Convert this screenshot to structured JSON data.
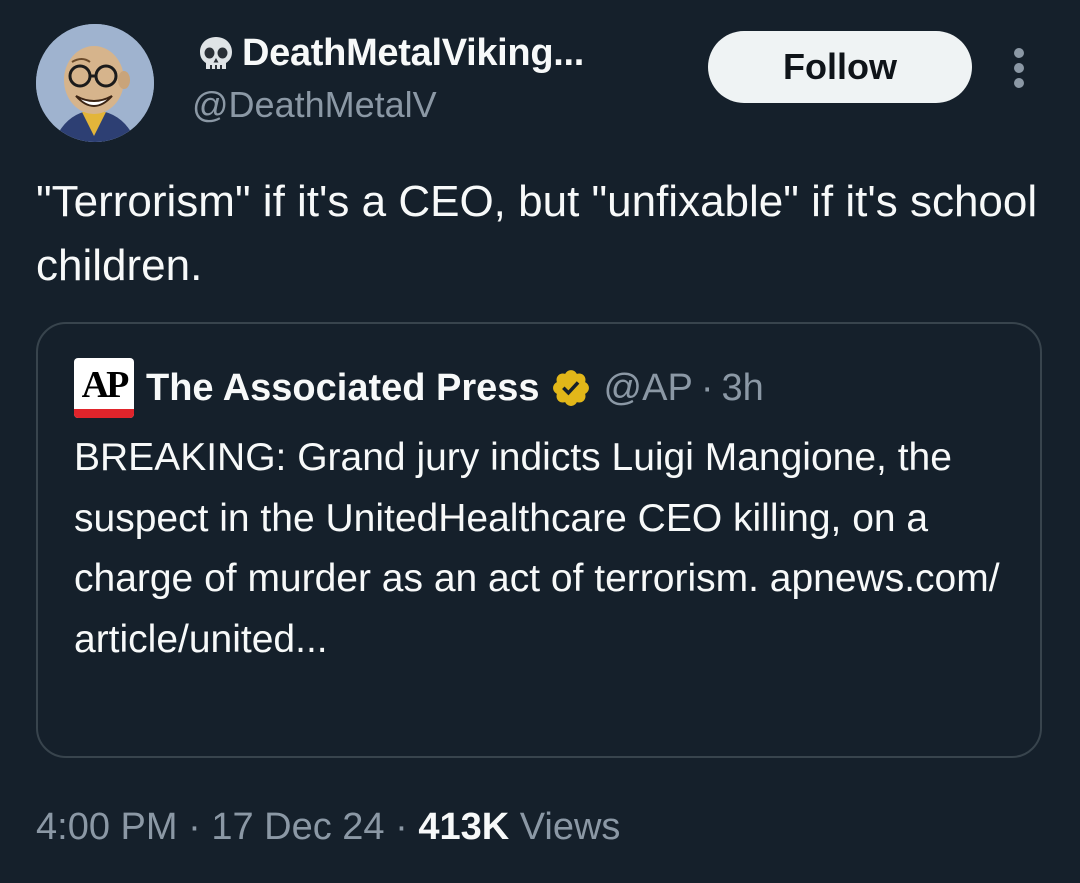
{
  "author": {
    "display_name": "DeathMetalViking...",
    "handle": "@DeathMetalV",
    "avatar_icon": "cartoon-face-avatar",
    "name_emoji_icon": "skull-icon"
  },
  "actions": {
    "follow_label": "Follow",
    "more_icon": "vertical-ellipsis-icon"
  },
  "tweet": {
    "text": "\"Terrorism\" if it's a CEO, but \"unfixable\" if it's school children."
  },
  "quoted_tweet": {
    "logo_text": "AP",
    "author_name": "The Associated Press",
    "verified_icon": "gold-verified-badge-icon",
    "handle": "@AP",
    "separator": "·",
    "time_ago": "3h",
    "text": "BREAKING: Grand jury indicts Luigi Mangione, the suspect in the UnitedHealthcare CEO killing, on a charge of murder as an act of terrorism. apnews.com/​article/united..."
  },
  "footer": {
    "time": "4:00 PM",
    "separator": "·",
    "date": "17 Dec 24",
    "views_count": "413K",
    "views_label": "Views"
  },
  "colors": {
    "background": "#15202b",
    "primary_text": "#f7f9f9",
    "secondary_text": "#8b98a5",
    "border": "#38444d",
    "follow_bg": "#eff3f4",
    "verified_gold": "#e2b719",
    "ap_red": "#e0242b"
  }
}
